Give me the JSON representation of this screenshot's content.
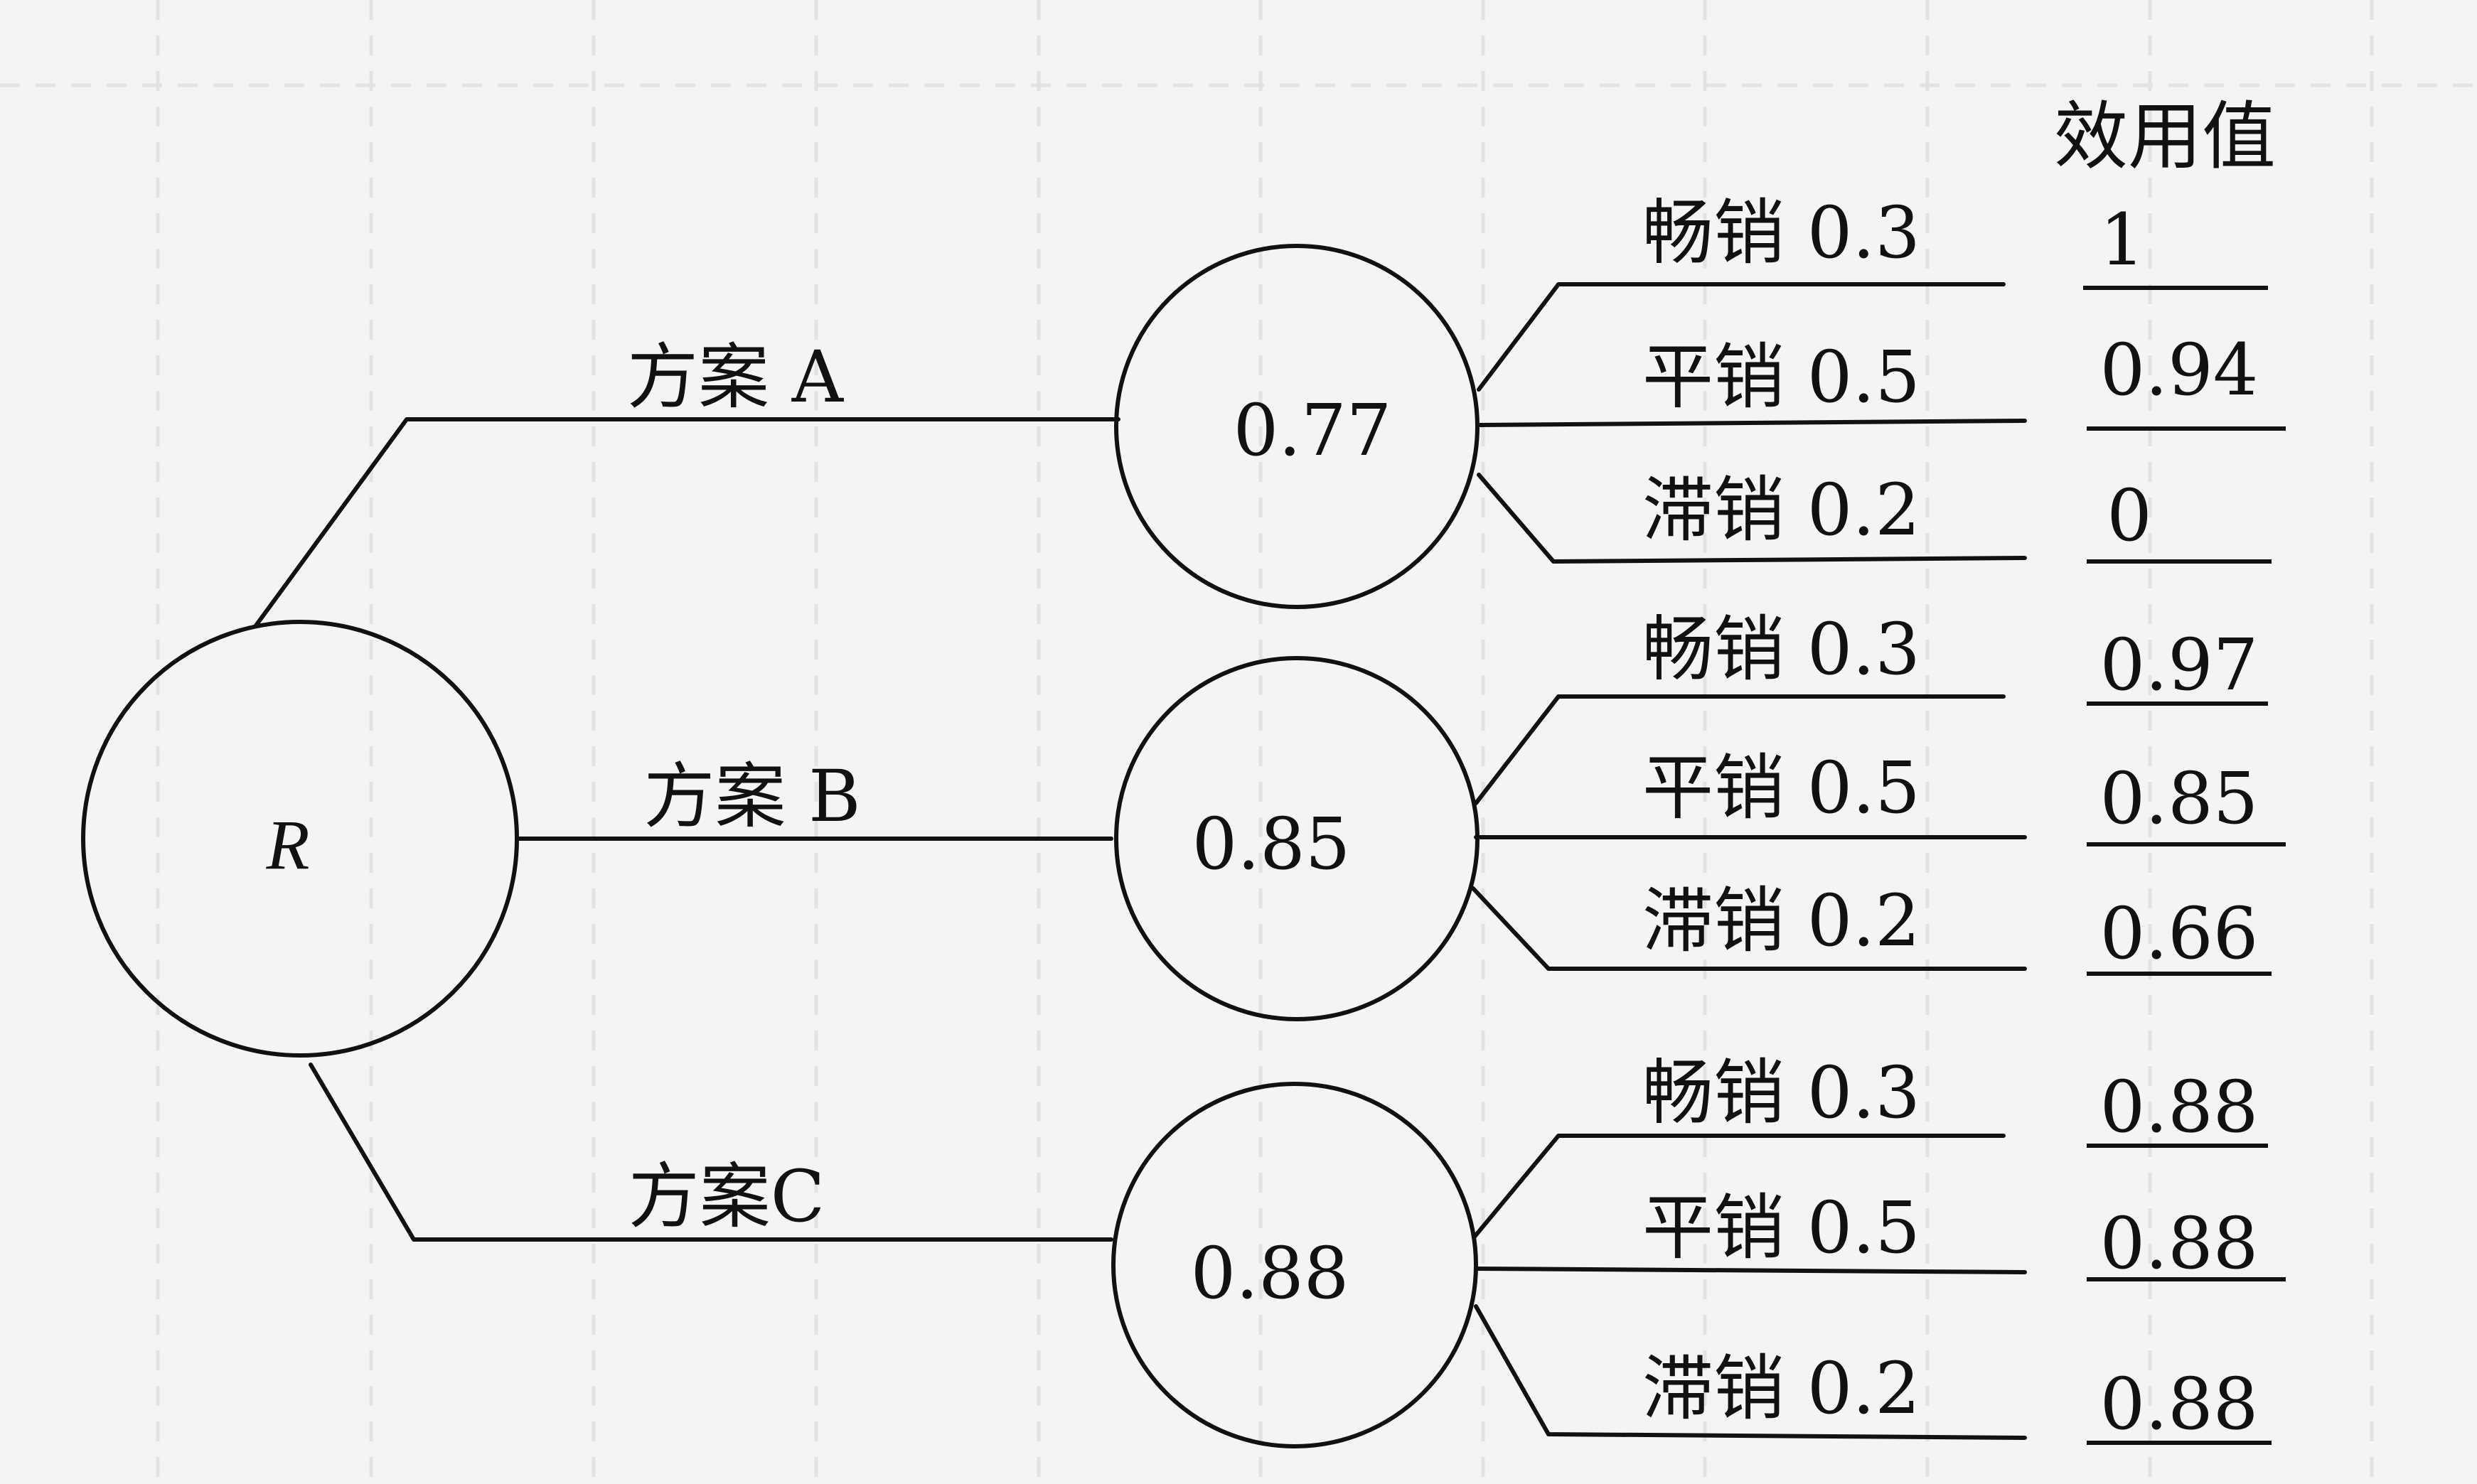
{
  "root": {
    "label": "R"
  },
  "header": {
    "utility_label": "效用值"
  },
  "plans": [
    {
      "label": "方案 A",
      "value": "0.77",
      "outcomes": [
        {
          "label": "畅销 0.3",
          "utility": "1"
        },
        {
          "label": "平销 0.5",
          "utility": "0.94"
        },
        {
          "label": "滞销 0.2",
          "utility": "0"
        }
      ]
    },
    {
      "label": "方案 B",
      "value": "0.85",
      "outcomes": [
        {
          "label": "畅销 0.3",
          "utility": "0.97"
        },
        {
          "label": "平销 0.5",
          "utility": "0.85"
        },
        {
          "label": "滞销 0.2",
          "utility": "0.66"
        }
      ]
    },
    {
      "label": "方案C",
      "value": "0.88",
      "outcomes": [
        {
          "label": "畅销 0.3",
          "utility": "0.88"
        },
        {
          "label": "平销 0.5",
          "utility": "0.88"
        },
        {
          "label": "滞销 0.2",
          "utility": "0.88"
        }
      ]
    }
  ]
}
